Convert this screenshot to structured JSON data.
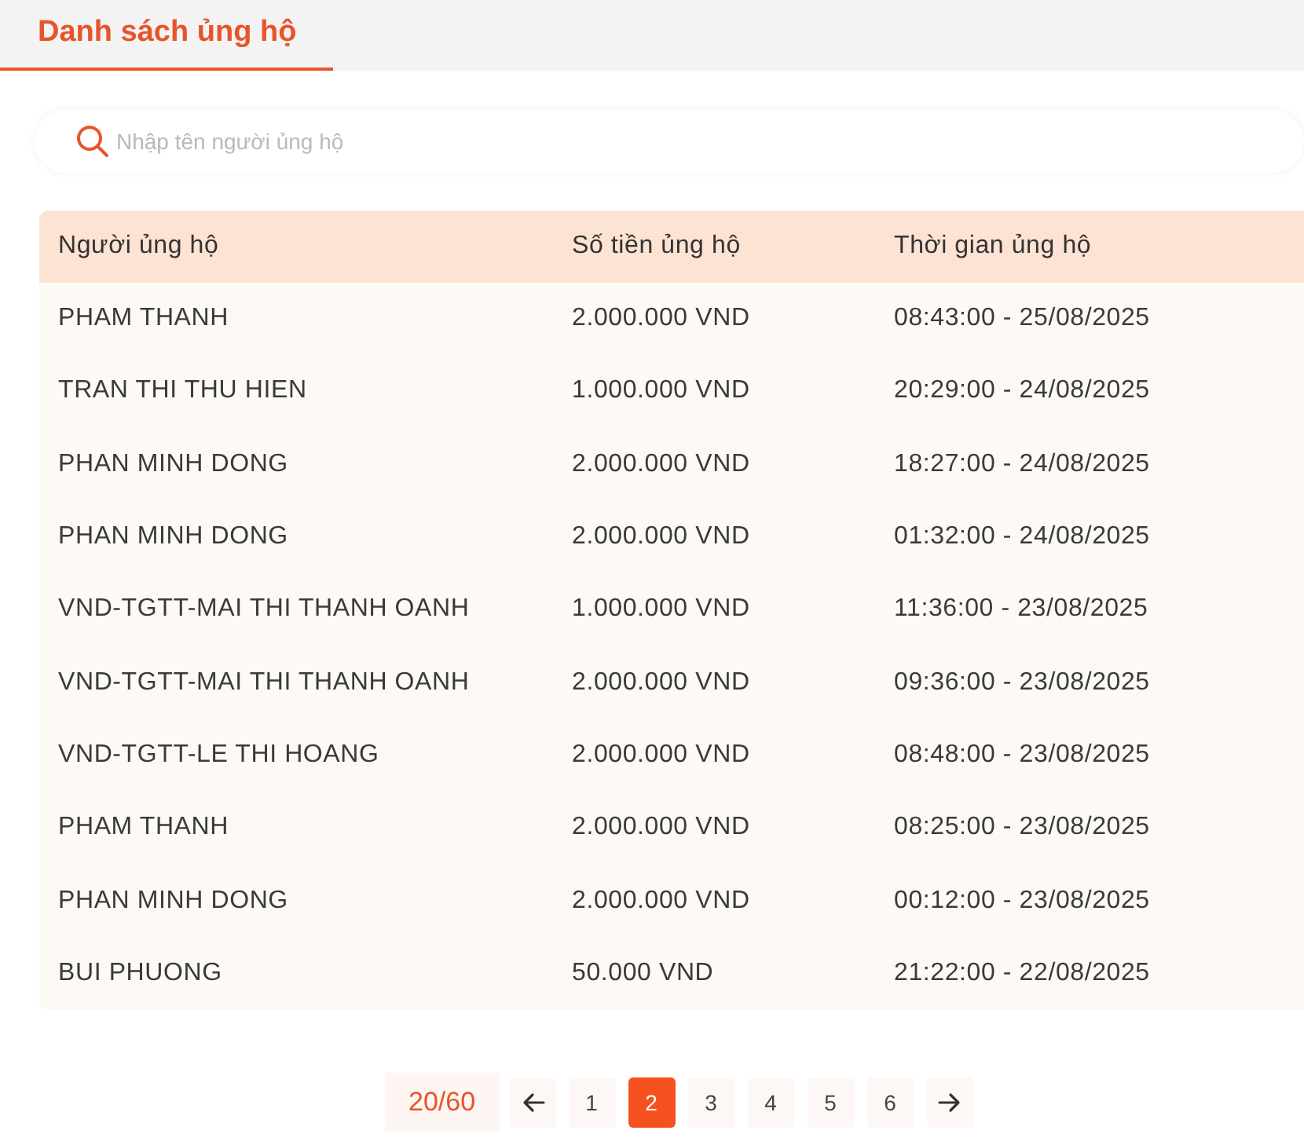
{
  "tabs": [
    {
      "label": "Danh sách ủng hộ",
      "selected": true
    }
  ],
  "search": {
    "placeholder": "Nhập tên người ủng hộ"
  },
  "table": {
    "columns": [
      "Người ủng hộ",
      "Số tiền ủng hộ",
      "Thời gian ủng hộ"
    ],
    "rows": [
      [
        "PHAM THANH",
        "2.000.000 VND",
        "08:43:00 - 25/08/2025"
      ],
      [
        "TRAN THI THU HIEN",
        "1.000.000 VND",
        "20:29:00 - 24/08/2025"
      ],
      [
        "PHAN MINH DONG",
        "2.000.000 VND",
        "18:27:00 - 24/08/2025"
      ],
      [
        "PHAN MINH DONG",
        "2.000.000 VND",
        "01:32:00 - 24/08/2025"
      ],
      [
        "VND-TGTT-MAI THI THANH OANH",
        "1.000.000 VND",
        "11:36:00 - 23/08/2025"
      ],
      [
        "VND-TGTT-MAI THI THANH OANH",
        "2.000.000 VND",
        "09:36:00 - 23/08/2025"
      ],
      [
        "VND-TGTT-LE THI HOANG",
        "2.000.000 VND",
        "08:48:00 - 23/08/2025"
      ],
      [
        "PHAM THANH",
        "2.000.000 VND",
        "08:25:00 - 23/08/2025"
      ],
      [
        "PHAN MINH DONG",
        "2.000.000 VND",
        "00:12:00 - 23/08/2025"
      ],
      [
        "BUI PHUONG",
        "50.000 VND",
        "21:22:00 - 22/08/2025"
      ]
    ]
  },
  "pagination": {
    "count": "20/60",
    "items": [
      {
        "kind": "prev"
      },
      {
        "kind": "page",
        "label": "1",
        "selected": false
      },
      {
        "kind": "page",
        "label": "2",
        "selected": true
      },
      {
        "kind": "page",
        "label": "3",
        "selected": false
      },
      {
        "kind": "page",
        "label": "4",
        "selected": false
      },
      {
        "kind": "page",
        "label": "5",
        "selected": false
      },
      {
        "kind": "page",
        "label": "6",
        "selected": false
      },
      {
        "kind": "next"
      }
    ]
  }
}
